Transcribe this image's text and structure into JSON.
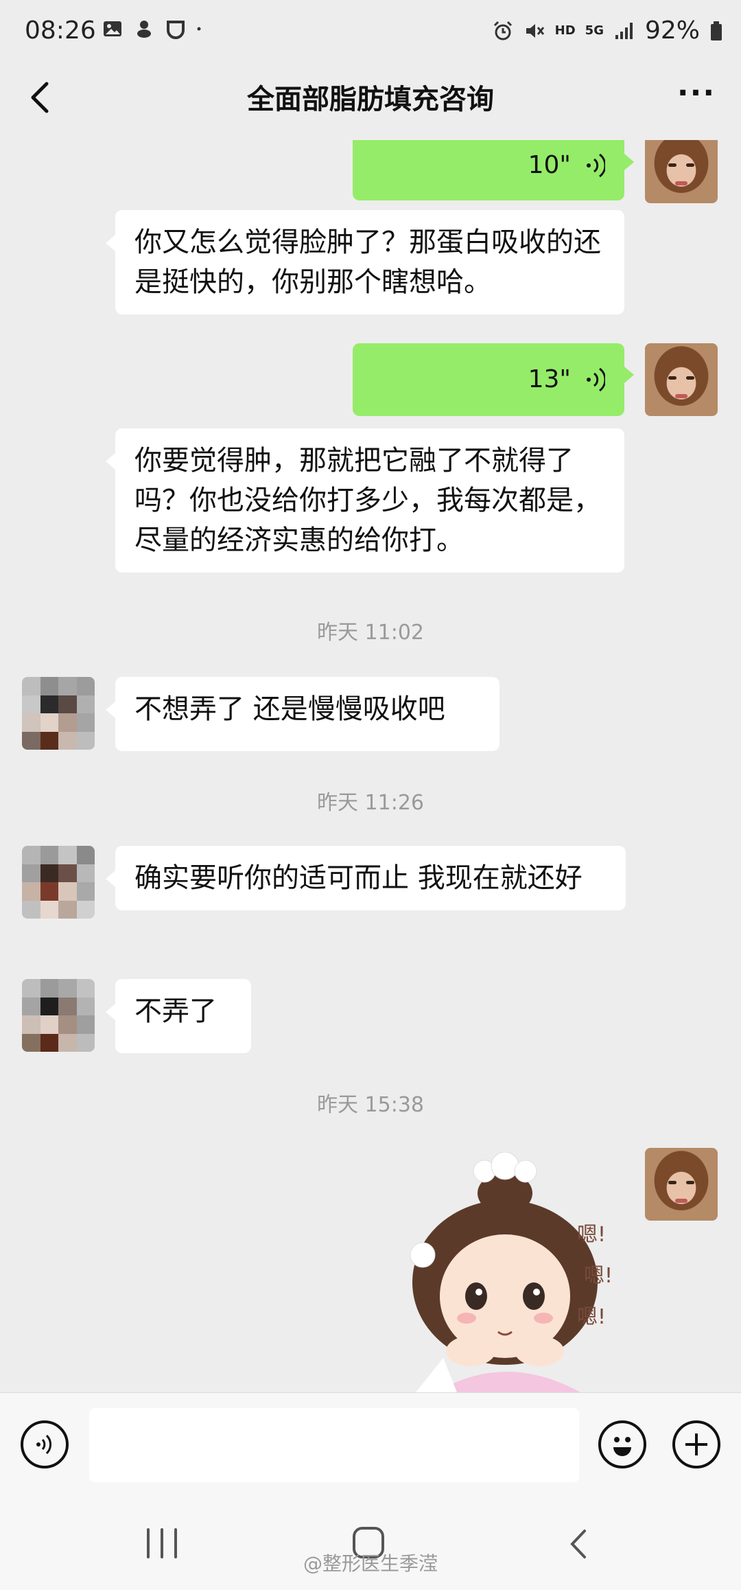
{
  "status_bar": {
    "time": "08:26",
    "network": "5G",
    "hd": "HD",
    "battery": "92%",
    "icons": [
      "image-icon",
      "game-icon",
      "app-icon",
      "dot-icon",
      "alarm-icon",
      "mute-icon",
      "signal-icon",
      "battery-icon"
    ]
  },
  "header": {
    "title": "全面部脂肪填充咨询",
    "back_icon": "chevron-left-icon",
    "more_label": "···"
  },
  "messages": [
    {
      "side": "out",
      "type": "voice",
      "duration": "10\""
    },
    {
      "side": "in",
      "type": "text",
      "text": "你又怎么觉得脸肿了？那蛋白吸收的还是挺快的，你别那个瞎想哈。"
    },
    {
      "side": "out",
      "type": "voice",
      "duration": "13\""
    },
    {
      "side": "in",
      "type": "text",
      "text": "你要觉得肿，那就把它融了不就得了吗？你也没给你打多少，我每次都是，尽量的经济实惠的给你打。"
    },
    {
      "type": "time",
      "text": "昨天 11:02"
    },
    {
      "side": "in",
      "type": "text",
      "text": "不想弄了 还是慢慢吸收吧"
    },
    {
      "type": "time",
      "text": "昨天 11:26"
    },
    {
      "side": "in",
      "type": "text",
      "text": "确实要听你的适可而止 我现在就还好"
    },
    {
      "side": "in",
      "type": "text",
      "text": "不弄了"
    },
    {
      "type": "time",
      "text": "昨天 15:38"
    },
    {
      "side": "out",
      "type": "sticker",
      "text": "嗯!"
    }
  ],
  "input_bar": {
    "voice_icon": "voice-input-icon",
    "emoji_icon": "emoji-icon",
    "plus_icon": "plus-icon"
  },
  "watermark": "@整形医生季滢",
  "colors": {
    "background": "#ededed",
    "bubble_out": "#95ec69",
    "bubble_in": "#ffffff"
  }
}
